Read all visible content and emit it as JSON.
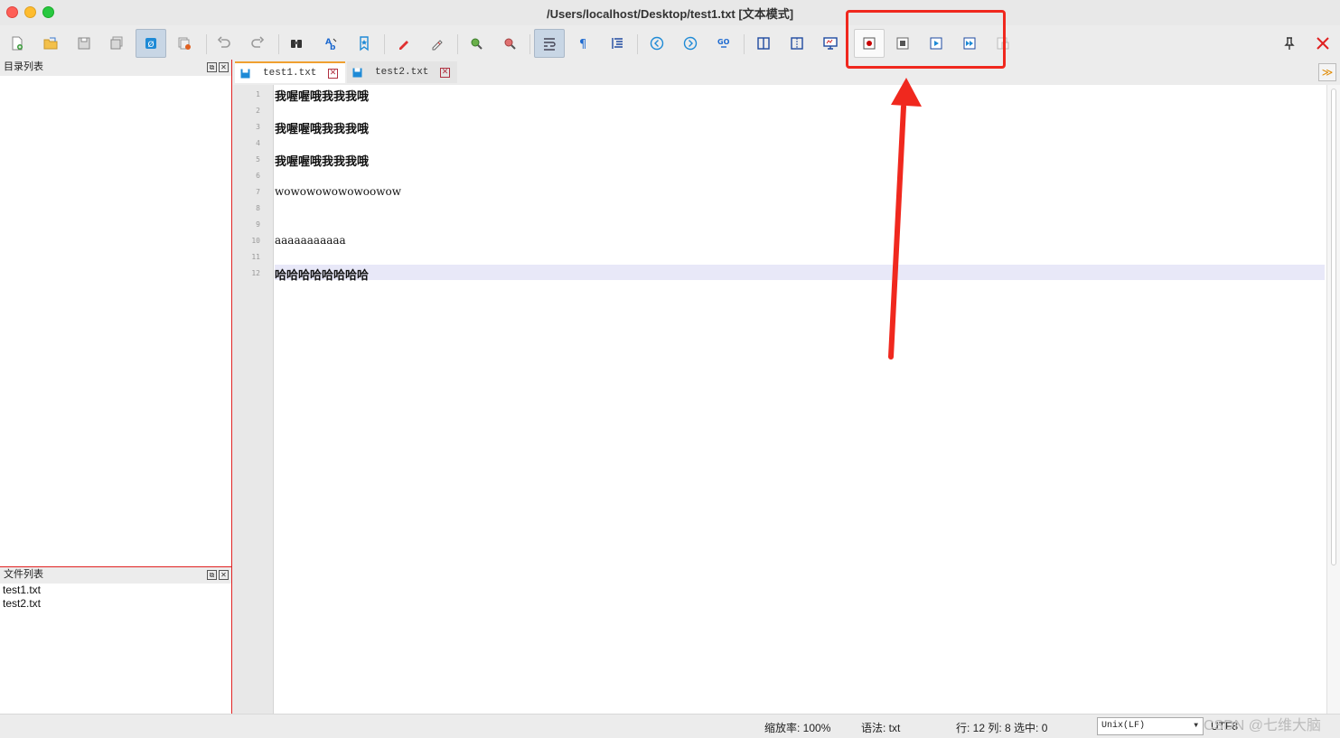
{
  "window": {
    "title": "/Users/localhost/Desktop/test1.txt [文本模式]"
  },
  "toolbar": {
    "buttons": [
      {
        "name": "new-file",
        "icon": "new-file-icon"
      },
      {
        "name": "open-file",
        "icon": "open-folder-icon"
      },
      {
        "name": "save",
        "icon": "save-icon"
      },
      {
        "name": "save-all",
        "icon": "save-all-icon"
      },
      {
        "name": "read-only",
        "icon": "lock-icon"
      },
      {
        "name": "close-all",
        "icon": "close-all-icon"
      },
      {
        "name": "undo",
        "icon": "undo-icon"
      },
      {
        "name": "redo",
        "icon": "redo-icon"
      },
      {
        "name": "find",
        "icon": "binoculars-icon"
      },
      {
        "name": "replace",
        "icon": "replace-icon"
      },
      {
        "name": "bookmark",
        "icon": "bookmark-icon"
      },
      {
        "name": "mark",
        "icon": "marker-icon"
      },
      {
        "name": "clear-mark",
        "icon": "eraser-icon"
      },
      {
        "name": "zoom-in",
        "icon": "zoom-in-icon"
      },
      {
        "name": "zoom-out",
        "icon": "zoom-out-icon"
      },
      {
        "name": "word-wrap",
        "icon": "wrap-icon"
      },
      {
        "name": "show-symbols",
        "icon": "pilcrow-icon"
      },
      {
        "name": "indent-guide",
        "icon": "indent-icon"
      },
      {
        "name": "prev-position",
        "icon": "chevron-left-circle-icon"
      },
      {
        "name": "next-position",
        "icon": "chevron-right-circle-icon"
      },
      {
        "name": "goto-line",
        "icon": "goto-icon"
      },
      {
        "name": "column-edit",
        "icon": "column-icon"
      },
      {
        "name": "split-view",
        "icon": "split-icon"
      },
      {
        "name": "monitor",
        "icon": "monitor-icon"
      },
      {
        "name": "macro-record",
        "icon": "record-icon"
      },
      {
        "name": "macro-stop",
        "icon": "stop-icon"
      },
      {
        "name": "macro-play",
        "icon": "play-icon"
      },
      {
        "name": "macro-play-multiple",
        "icon": "fast-forward-icon"
      },
      {
        "name": "macro-save",
        "icon": "macro-save-icon"
      },
      {
        "name": "pin",
        "icon": "pin-icon"
      },
      {
        "name": "close",
        "icon": "close-icon"
      }
    ]
  },
  "left_panel": {
    "dir_title": "目录列表",
    "file_title": "文件列表",
    "files": [
      "test1.txt",
      "test2.txt"
    ]
  },
  "tabs": [
    {
      "label": "test1.txt",
      "active": true
    },
    {
      "label": "test2.txt",
      "active": false
    }
  ],
  "editor": {
    "lines": [
      {
        "num": "1",
        "text": "我喔喔哦我我我哦"
      },
      {
        "num": "2",
        "text": ""
      },
      {
        "num": "3",
        "text": "我喔喔哦我我我哦"
      },
      {
        "num": "4",
        "text": ""
      },
      {
        "num": "5",
        "text": "我喔喔哦我我我哦"
      },
      {
        "num": "6",
        "text": ""
      },
      {
        "num": "7",
        "text": "wowowowowowoowow"
      },
      {
        "num": "8",
        "text": ""
      },
      {
        "num": "9",
        "text": ""
      },
      {
        "num": "10",
        "text": "aaaaaaaaaaa"
      },
      {
        "num": "11",
        "text": ""
      },
      {
        "num": "12",
        "text": "哈哈哈哈哈哈哈哈"
      }
    ],
    "current_line": 12
  },
  "statusbar": {
    "zoom": "缩放率: 100%",
    "syntax": "语法:  txt",
    "position": "行: 12 列: 8 选中: 0",
    "eol": "Unix(LF)",
    "encoding": "UTF8",
    "watermark": "CSDN @七维大脑"
  },
  "colors": {
    "annotation": "#f0281e",
    "panel_border": "#e02020",
    "current_line": "#e8e8f8",
    "tab_accent": "#f0a030"
  }
}
